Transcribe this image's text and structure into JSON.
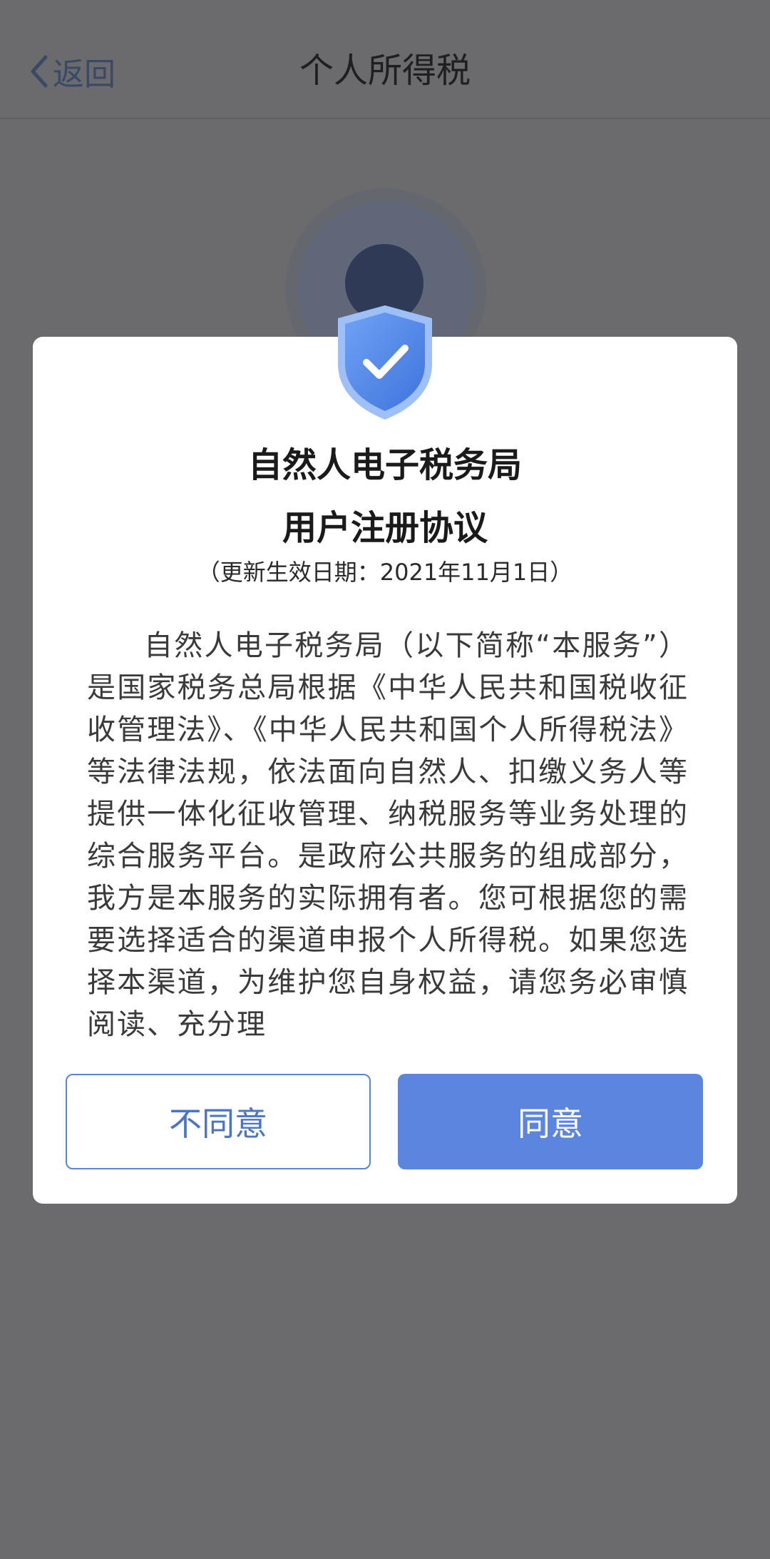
{
  "nav": {
    "back_label": "返回",
    "title": "个人所得税"
  },
  "dialog": {
    "title_line1": "自然人电子税务局",
    "title_line2": "用户注册协议",
    "subtitle": "（更新生效日期：2021年11月1日）",
    "body": "自然人电子税务局（以下简称“本服务”）是国家税务总局根据《中华人民共和国税收征收管理法》、《中华人民共和国个人所得税法》等法律法规，依法面向自然人、扣缴义务人等提供一体化征收管理、纳税服务等业务处理的综合服务平台。是政府公共服务的组成部分，我方是本服务的实际拥有者。您可根据您的需要选择适合的渠道申报个人所得税。如果您选择本渠道，为维护您自身权益，请您务必审慎阅读、充分理",
    "disagree_label": "不同意",
    "agree_label": "同意"
  },
  "colors": {
    "overlay": "#6b6b6d",
    "accent": "#5c85e0",
    "shield": "#4f86e8"
  },
  "icons": {
    "back": "chevron-left-icon",
    "shield": "shield-check-icon"
  }
}
